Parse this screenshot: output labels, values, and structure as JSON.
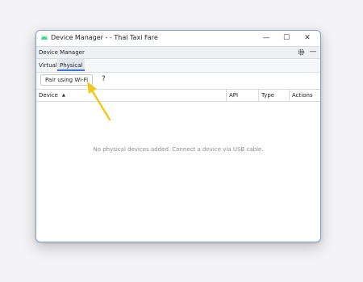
{
  "window": {
    "title": "Device Manager - - Thai Taxi Fare",
    "controls": {
      "minimize": "—",
      "maximize": "☐",
      "close": "✕"
    }
  },
  "toolbar": {
    "label": "Device Manager",
    "settings_icon": "gear-icon",
    "hide_icon": "minimize-panel-icon",
    "hide_glyph": "—"
  },
  "tabs": [
    {
      "label": "Virtual",
      "selected": false
    },
    {
      "label": "Physical",
      "selected": true
    }
  ],
  "actions": {
    "pair_button": "Pair using Wi-Fi",
    "help_glyph": "?"
  },
  "table": {
    "columns": [
      "Device",
      "API",
      "Type",
      "Actions"
    ],
    "sort_indicator": "▲",
    "empty_message": "No physical devices added. Connect a device via USB cable."
  },
  "colors": {
    "accent": "#3d74d8",
    "arrow": "#f5c518",
    "android_logo": "#3ddc84"
  }
}
